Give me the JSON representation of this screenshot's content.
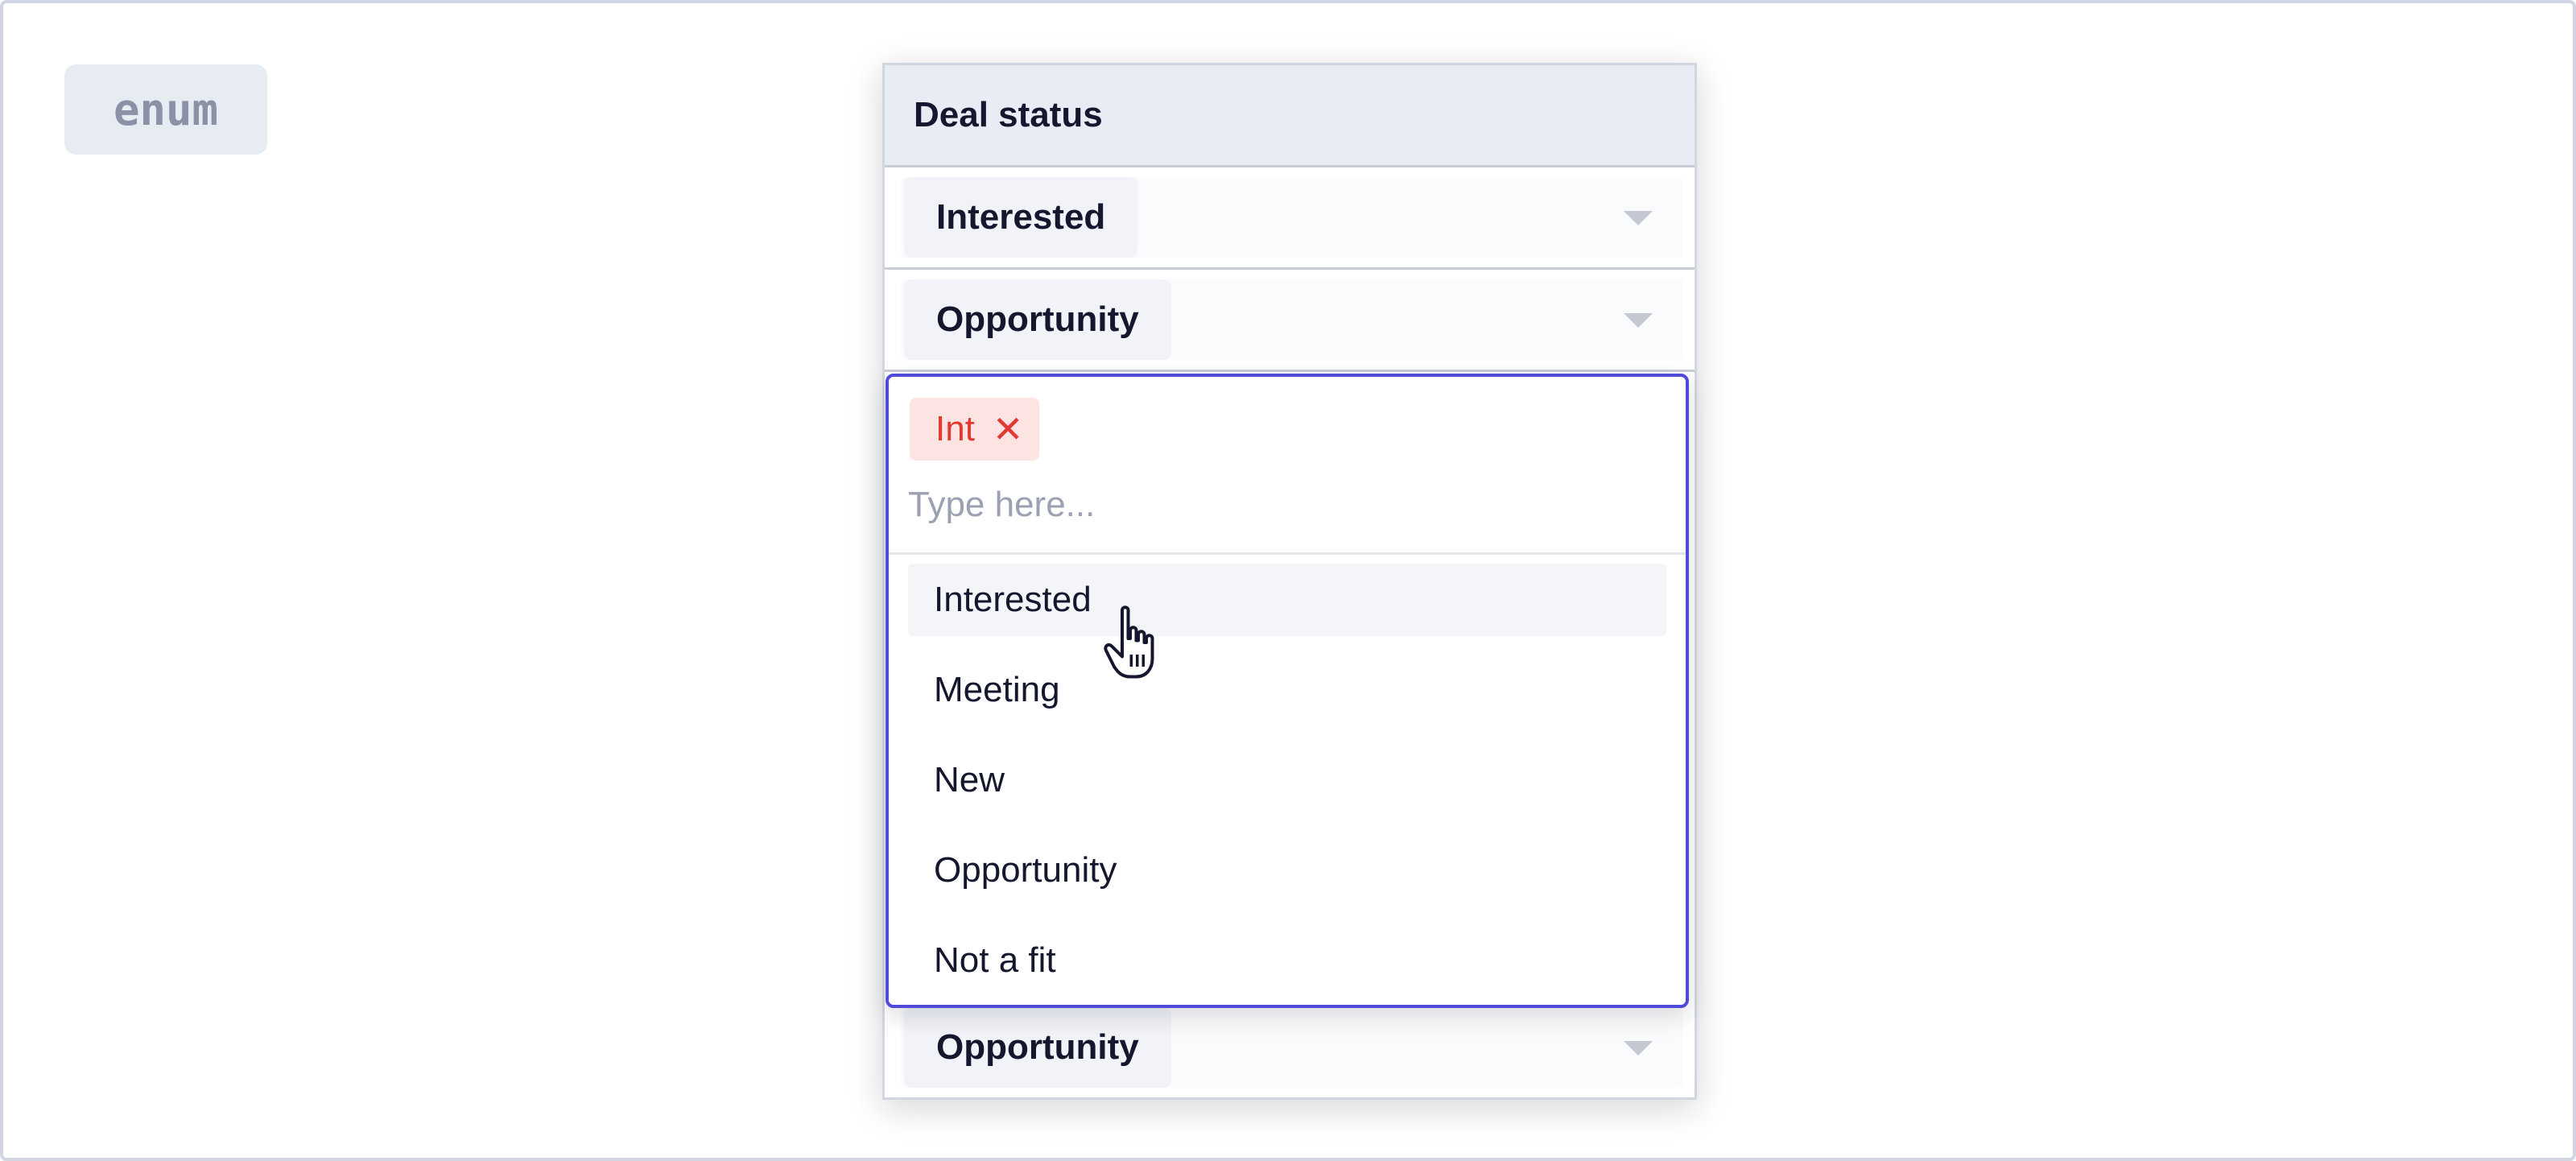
{
  "type_badge": "enum",
  "table": {
    "column_header": "Deal status",
    "rows": [
      {
        "value": "Interested"
      },
      {
        "value": "Opportunity"
      }
    ],
    "last_row": {
      "value": "Opportunity"
    }
  },
  "editor": {
    "selected_tag": "Int",
    "remove_glyph": "✕",
    "input_value": "",
    "input_placeholder": "Type here...",
    "options": [
      "Interested",
      "Meeting",
      "New",
      "Opportunity",
      "Not a fit"
    ],
    "hovered_option": "Interested"
  },
  "colors": {
    "accent": "#4f4bd8",
    "tag_text": "#e03a32",
    "tag_bg": "#fde4e3",
    "header_bg": "#e8ecf4"
  },
  "icons": {
    "cursor": "hand-pointer-icon",
    "dropdown": "caret-down-icon",
    "remove": "close-icon"
  }
}
